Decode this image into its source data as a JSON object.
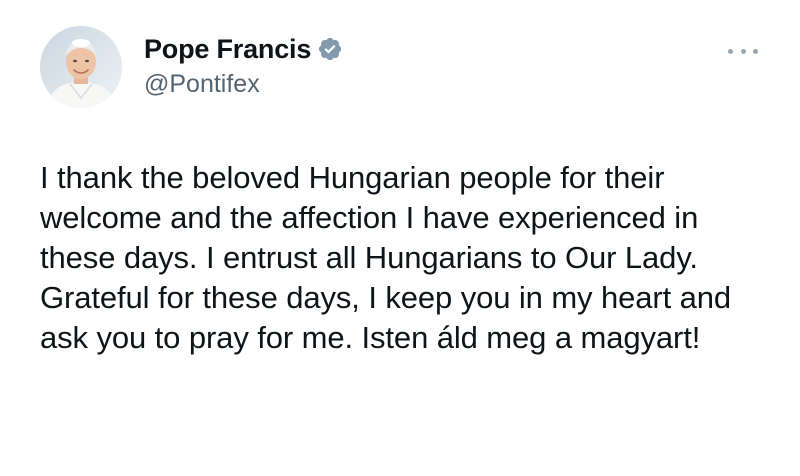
{
  "tweet": {
    "author": {
      "display_name": "Pope Francis",
      "handle": "@Pontifex",
      "verified": true,
      "avatar_icon": "avatar-photo",
      "verified_icon": "verified-badge-icon"
    },
    "more_icon": "more-options-icon",
    "text": "I thank the beloved Hungarian people for their welcome and the affection I have experienced in these days. I entrust all Hungarians to Our Lady. Grateful for these days, I keep you in my heart and ask you to pray for me. Isten áld meg a magyart!"
  },
  "colors": {
    "text_primary": "#0f1419",
    "text_secondary": "#536471",
    "verified_badge": "#829aab",
    "background": "#ffffff"
  }
}
